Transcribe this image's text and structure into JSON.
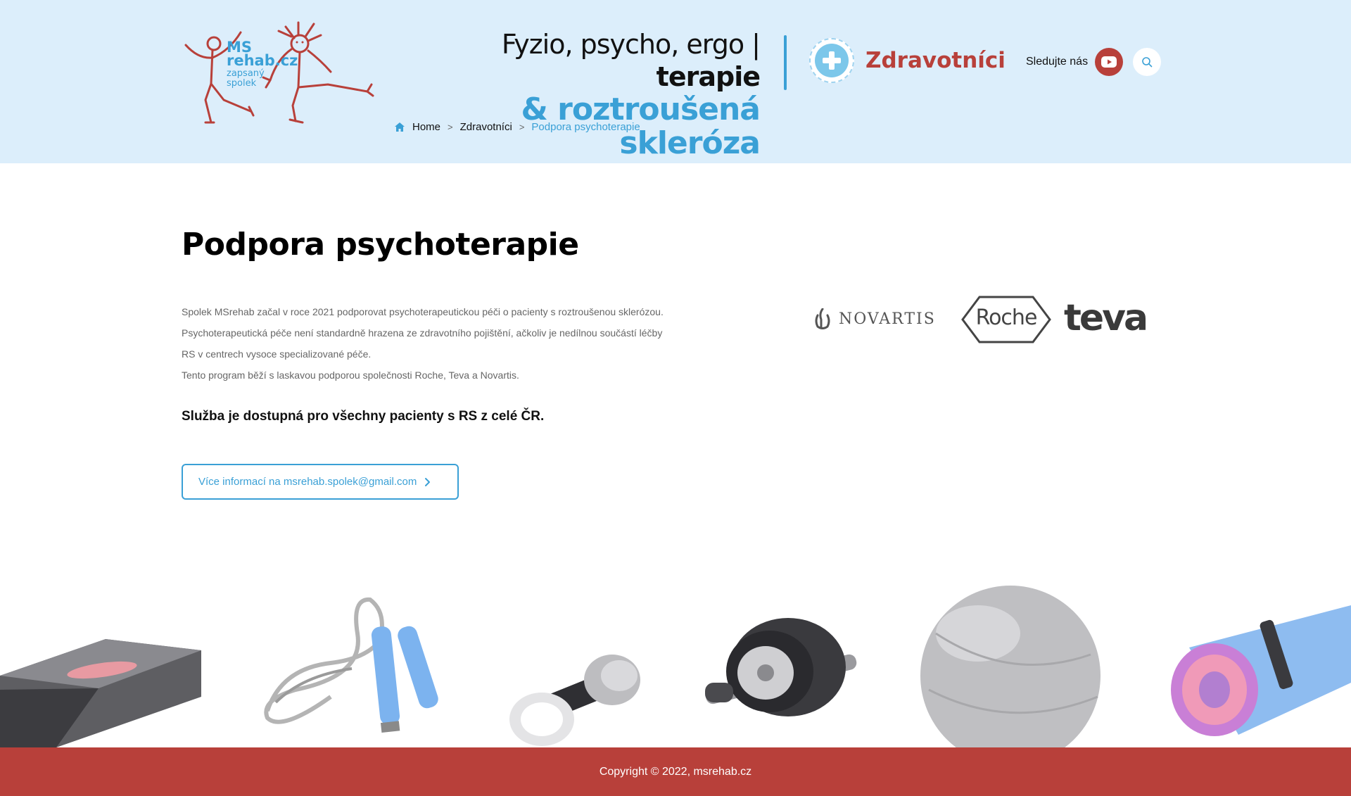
{
  "header": {
    "logo": {
      "line1": "MS",
      "line2": "rehab.cz",
      "sub1": "zapsaný",
      "sub2": "spolek",
      "icon": "stick-figures-logo"
    },
    "tagline": {
      "line1_regular": "Fyzio, psycho, ergo | ",
      "line1_bold": "terapie",
      "line2": "& roztroušená skleróza"
    },
    "section": {
      "label": "Zdravotníci",
      "icon": "medical-plus-icon"
    },
    "follow_label": "Sledujte nás",
    "youtube_icon": "youtube-icon",
    "search_icon": "search-icon"
  },
  "breadcrumb": {
    "home": "Home",
    "parent": "Zdravotníci",
    "current": "Podpora psychoterapie",
    "separator": ">"
  },
  "main": {
    "title": "Podpora psychoterapie",
    "paragraphs": [
      "Spolek MSrehab začal v roce 2021 podporovat psychoterapeutickou péči o pacienty s roztroušenou sklerózou.",
      "Psychoterapeutická péče není standardně hrazena ze zdravotního pojištění, ačkoliv je nedílnou součástí léčby",
      "RS v centrech vysoce specializované péče.",
      "Tento program běží s laskavou podporou společnosti Roche, Teva a Novartis."
    ],
    "lead": "Služba je dostupná pro všechny pacienty s RS z celé ČR.",
    "cta_label": "Více informací na msrehab.spolek@gmail.com"
  },
  "sponsors": {
    "novartis": "NOVARTIS",
    "roche": "Roche",
    "teva": "teva"
  },
  "equipment": [
    "step-platform",
    "jump-rope",
    "dumbbells",
    "ab-wheel",
    "fitness-ball",
    "yoga-mat"
  ],
  "footer": {
    "copyright": "Copyright © 2022, msrehab.cz"
  },
  "colors": {
    "header_bg": "#dceefb",
    "accent_blue": "#3aa0d6",
    "brand_red": "#b8403a"
  }
}
